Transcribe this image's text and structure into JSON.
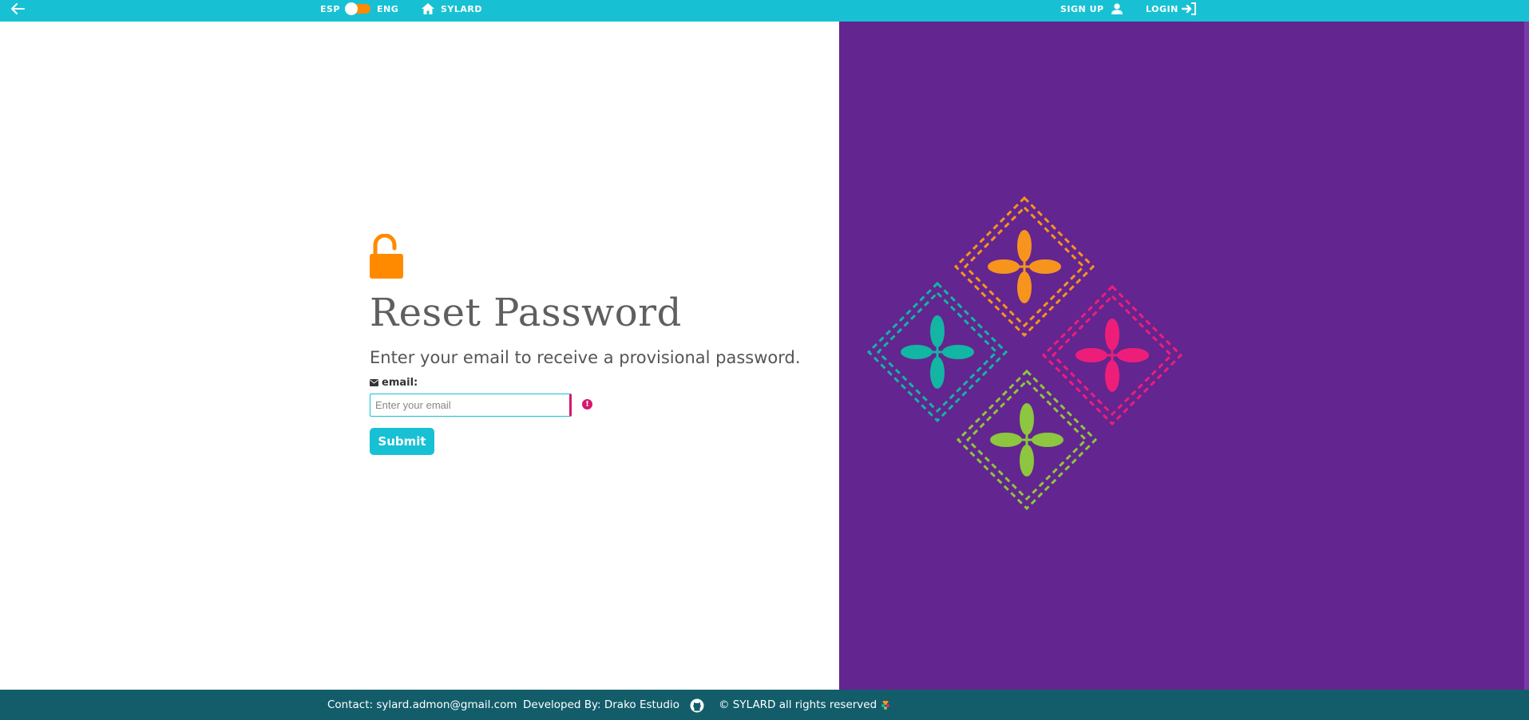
{
  "topbar": {
    "back_icon": "arrow-left-icon",
    "lang_left": "ESP",
    "lang_right": "ENG",
    "home_icon": "home-icon",
    "home_label": "SYLARD",
    "signup_label": "SIGN UP",
    "signup_icon": "user-icon",
    "login_label": "LOGIN",
    "login_icon": "login-icon"
  },
  "form": {
    "lock_icon": "lock-open-icon",
    "title": "Reset Password",
    "subtitle": "Enter your email to receive a provisional password.",
    "email_icon": "envelope-icon",
    "email_label": "email:",
    "email_value": "",
    "email_placeholder": "Enter your email",
    "submit_label": "Submit"
  },
  "footer": {
    "contact": "Contact: sylard.admon@gmail.com",
    "developer": "Developed By: Drako Estudio",
    "github_icon": "github-icon",
    "copyright": "© SYLARD all rights reserved",
    "logo": "sylard-logo"
  },
  "colors": {
    "accent": "#17c1d3",
    "footer": "#135d6b",
    "panel": "#63258f",
    "lock": "#ff8a00",
    "error": "#d6186f",
    "motif_orange": "#f7941d",
    "motif_teal": "#13b5a3",
    "motif_pink": "#ed1e79",
    "motif_green": "#8dc63f"
  }
}
